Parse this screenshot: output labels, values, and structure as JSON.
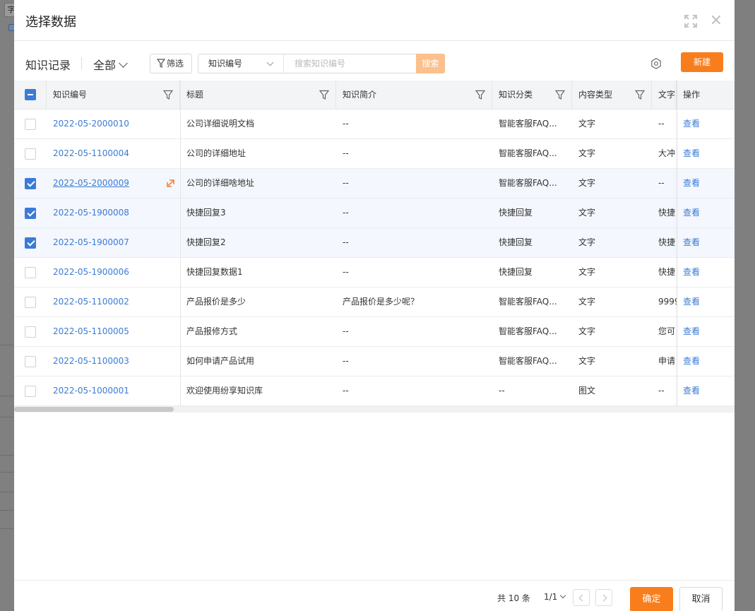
{
  "background": {
    "stub_char": "字"
  },
  "modal": {
    "title": "选择数据",
    "icons": {
      "expand": "expand-icon",
      "close": "close-icon"
    }
  },
  "toolbar": {
    "title": "知识记录",
    "scope": "全部",
    "filter_label": "筛选",
    "search_field": "知识编号",
    "search_placeholder": "搜索知识编号",
    "search_button": "搜索",
    "new_button": "新建"
  },
  "table": {
    "headers": {
      "id": "知识编号",
      "title": "标题",
      "summary": "知识简介",
      "category": "知识分类",
      "content_type": "内容类型",
      "text": "文字",
      "action": "操作"
    },
    "rows": [
      {
        "checked": false,
        "id": "2022-05-2000010",
        "title": "公司详细说明文档",
        "summary": "--",
        "category": "智能客服FAQ...",
        "content_type": "文字",
        "text": "--",
        "action": "查看"
      },
      {
        "checked": false,
        "id": "2022-05-1100004",
        "title": "公司的详细地址",
        "summary": "--",
        "category": "智能客服FAQ...",
        "content_type": "文字",
        "text": "大冲",
        "action": "查看"
      },
      {
        "checked": true,
        "id": "2022-05-2000009",
        "title": "公司的详细啥地址",
        "summary": "--",
        "category": "智能客服FAQ...",
        "content_type": "文字",
        "text": "--",
        "action": "查看"
      },
      {
        "checked": true,
        "id": "2022-05-1900008",
        "title": "快捷回复3",
        "summary": "--",
        "category": "快捷回复",
        "content_type": "文字",
        "text": "快捷",
        "action": "查看"
      },
      {
        "checked": true,
        "id": "2022-05-1900007",
        "title": "快捷回复2",
        "summary": "--",
        "category": "快捷回复",
        "content_type": "文字",
        "text": "快捷",
        "action": "查看"
      },
      {
        "checked": false,
        "id": "2022-05-1900006",
        "title": "快捷回复数据1",
        "summary": "--",
        "category": "快捷回复",
        "content_type": "文字",
        "text": "快捷",
        "action": "查看"
      },
      {
        "checked": false,
        "id": "2022-05-1100002",
        "title": "产品报价是多少",
        "summary": "产品报价是多少呢？",
        "category": "智能客服FAQ...",
        "content_type": "文字",
        "text": "9999",
        "action": "查看"
      },
      {
        "checked": false,
        "id": "2022-05-1100005",
        "title": "产品报修方式",
        "summary": "--",
        "category": "智能客服FAQ...",
        "content_type": "文字",
        "text": "您可",
        "action": "查看"
      },
      {
        "checked": false,
        "id": "2022-05-1100003",
        "title": "如何申请产品试用",
        "summary": "--",
        "category": "智能客服FAQ...",
        "content_type": "文字",
        "text": "申请",
        "action": "查看"
      },
      {
        "checked": false,
        "id": "2022-05-1000001",
        "title": "欢迎使用纷享知识库",
        "summary": "--",
        "category": "--",
        "content_type": "图文",
        "text": "--",
        "action": "查看"
      }
    ]
  },
  "footer": {
    "total": "共 10 条",
    "page": "1/1",
    "ok": "确定",
    "cancel": "取消"
  },
  "colors": {
    "accent": "#f87e1d",
    "link": "#3b7bd6",
    "search_button": "#fbc08c"
  }
}
